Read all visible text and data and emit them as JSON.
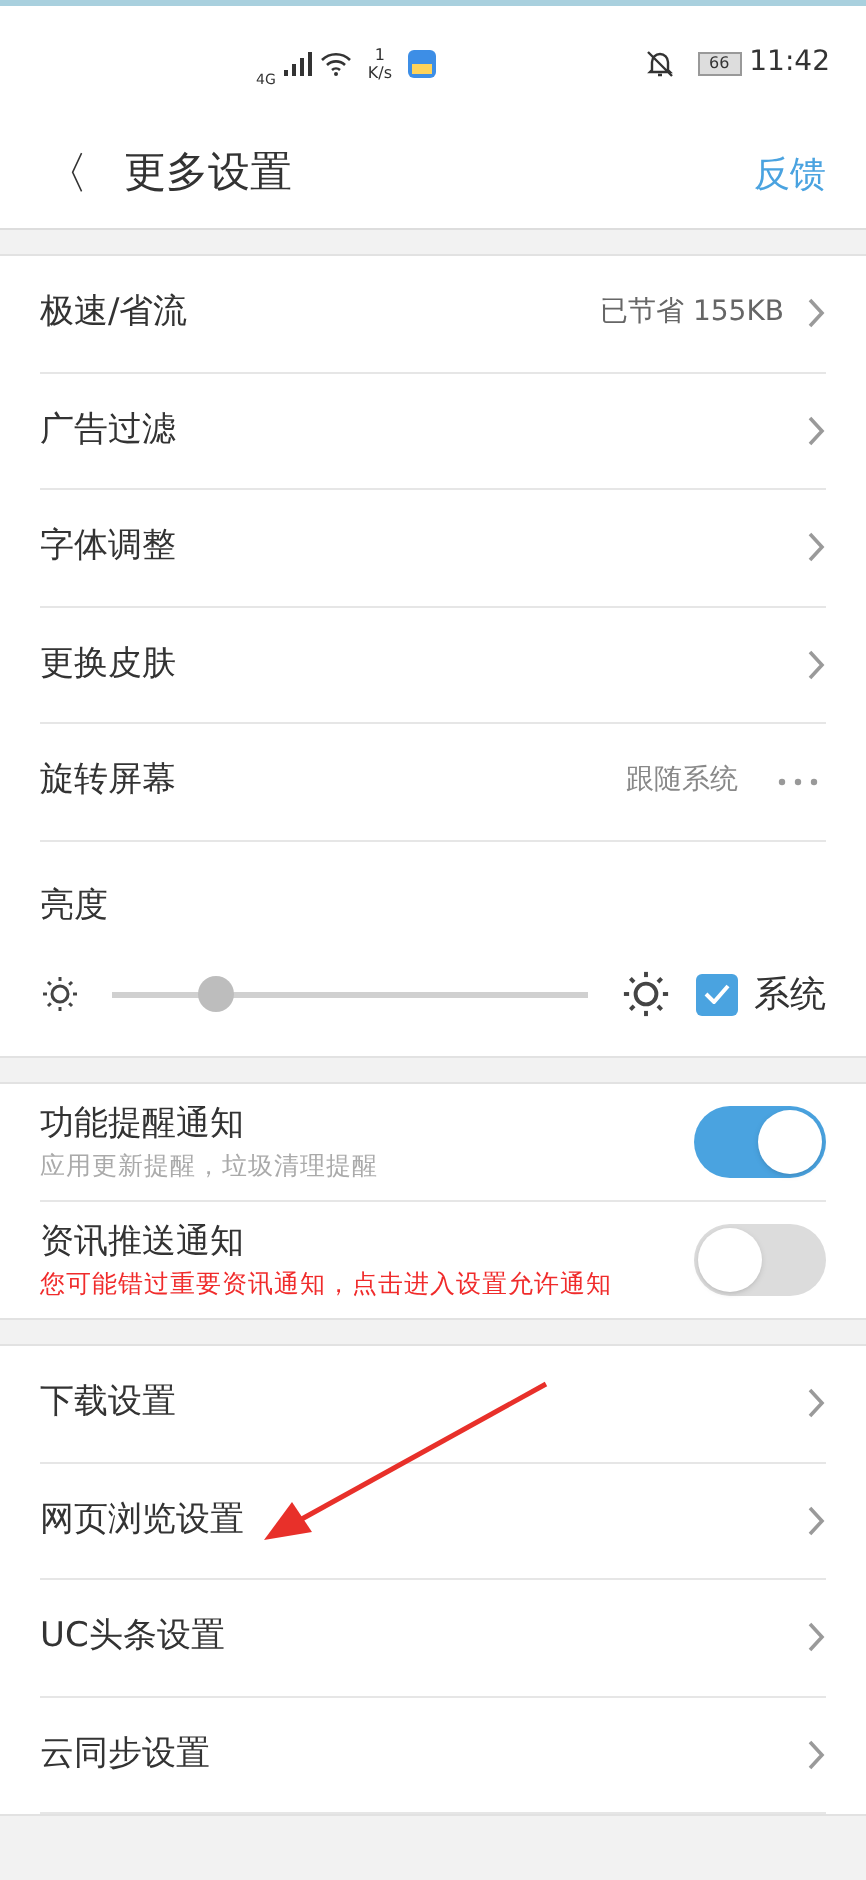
{
  "status_bar": {
    "network": "4G",
    "speed_value": "1",
    "speed_unit": "K/s",
    "battery": "66",
    "time": "11:42"
  },
  "header": {
    "back": "〈",
    "title": "更多设置",
    "action": "反馈"
  },
  "sections": [
    {
      "items": [
        {
          "kind": "nav",
          "label": "极速/省流",
          "value": "已节省 155KB"
        },
        {
          "kind": "nav",
          "label": "广告过滤"
        },
        {
          "kind": "nav",
          "label": "字体调整"
        },
        {
          "kind": "nav",
          "label": "更换皮肤"
        },
        {
          "kind": "more",
          "label": "旋转屏幕",
          "value": "跟随系统"
        },
        {
          "kind": "brightness",
          "label": "亮度",
          "level": 0.22,
          "checked": true,
          "check_label": "系统"
        }
      ]
    },
    {
      "items": [
        {
          "kind": "toggle",
          "label": "功能提醒通知",
          "subtitle": "应用更新提醒，垃圾清理提醒",
          "alert": false,
          "on": true
        },
        {
          "kind": "toggle",
          "label": "资讯推送通知",
          "subtitle": "您可能错过重要资讯通知，点击进入设置允许通知",
          "alert": true,
          "on": false
        }
      ]
    },
    {
      "items": [
        {
          "kind": "nav",
          "label": "下载设置"
        },
        {
          "kind": "nav",
          "label": "网页浏览设置"
        },
        {
          "kind": "nav",
          "label": "UC头条设置"
        },
        {
          "kind": "nav",
          "label": "云同步设置"
        }
      ]
    }
  ]
}
